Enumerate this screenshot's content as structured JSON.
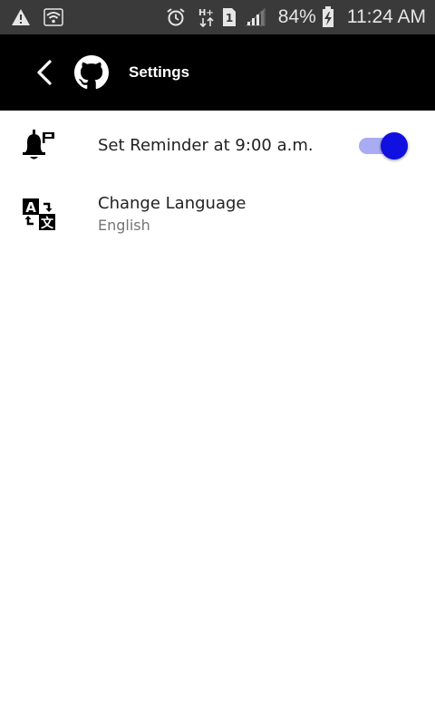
{
  "status_bar": {
    "battery_percent": "84%",
    "time": "11:24 AM",
    "sim_slot": "1",
    "icons": [
      "warning-icon",
      "wifi-icon",
      "alarm-icon",
      "hplus-data-icon",
      "sim-icon",
      "signal-icon",
      "battery-charging-icon"
    ]
  },
  "app_bar": {
    "title": "Settings",
    "background": "#000000"
  },
  "settings": {
    "reminder": {
      "label": "Set Reminder at 9:00 a.m.",
      "enabled": true,
      "icon": "bell-flag-icon"
    },
    "language": {
      "label": "Change Language",
      "value": "English",
      "icon": "translate-icon"
    }
  },
  "colors": {
    "accent": "#1010e0",
    "track_on": "#a9acf2",
    "status_bar": "#3a3a3a"
  }
}
